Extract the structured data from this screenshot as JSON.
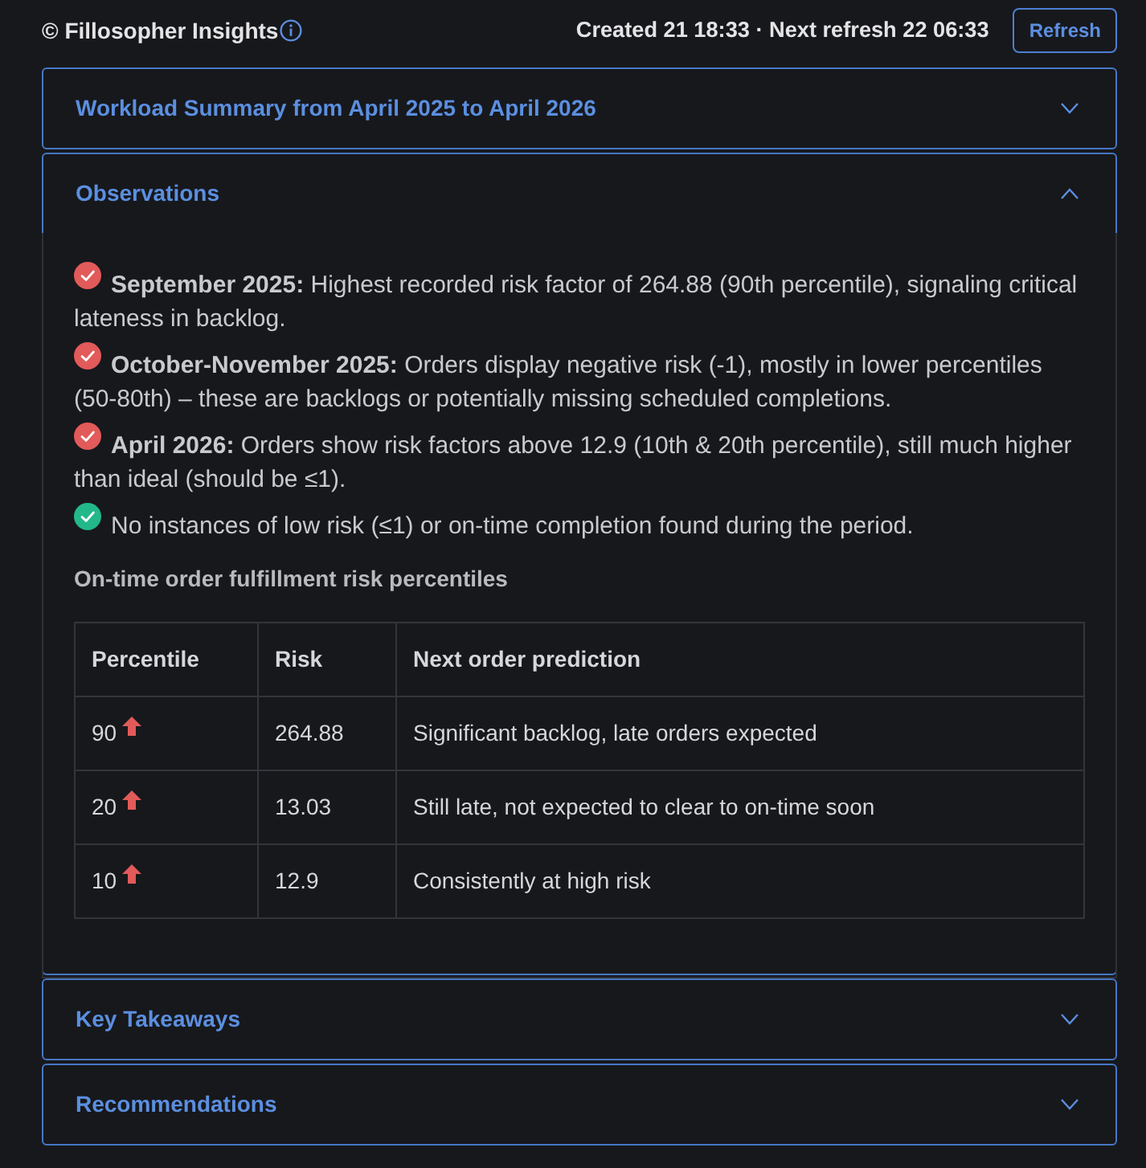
{
  "header": {
    "brand": "© Fillosopher Insights",
    "timestamp": "Created 21 18:33 · Next refresh 22 06:33",
    "refresh_button": "Refresh"
  },
  "sections": [
    {
      "title": "Workload Summary from April 2025 to April 2026",
      "expanded": false
    },
    {
      "title": "Observations",
      "expanded": true,
      "observations": [
        {
          "kind": "risk",
          "text": "**September 2025:** Highest recorded risk factor of 264.88 (90th percentile), signaling critical lateness in backlog."
        },
        {
          "kind": "risk",
          "text": "**October-November 2025:** Orders display negative risk (-1), mostly in lower percentiles (50-80th) – these are backlogs or potentially missing scheduled completions."
        },
        {
          "kind": "risk",
          "text": "**April 2026:** Orders show risk factors above 12.9 (10th & 20th percentile), still much higher than ideal (should be ≤1)."
        },
        {
          "kind": "ok",
          "text": "No instances of low risk (≤1) or on-time completion found during the period."
        }
      ],
      "table_title": "On-time order fulfillment risk percentiles",
      "table": {
        "columns": [
          "Percentile",
          "Risk",
          "Next order prediction"
        ],
        "rows": [
          {
            "kind": "up",
            "percentile": "90",
            "risk": "264.88",
            "prediction": "Significant backlog, late orders expected"
          },
          {
            "kind": "up",
            "percentile": "20",
            "risk": "13.03",
            "prediction": "Still late, not expected to clear to on-time soon"
          },
          {
            "kind": "up",
            "percentile": "10",
            "risk": "12.9",
            "prediction": "Consistently at high risk"
          }
        ]
      }
    },
    {
      "title": "Key Takeaways",
      "expanded": false
    },
    {
      "title": "Recommendations",
      "expanded": false
    }
  ]
}
